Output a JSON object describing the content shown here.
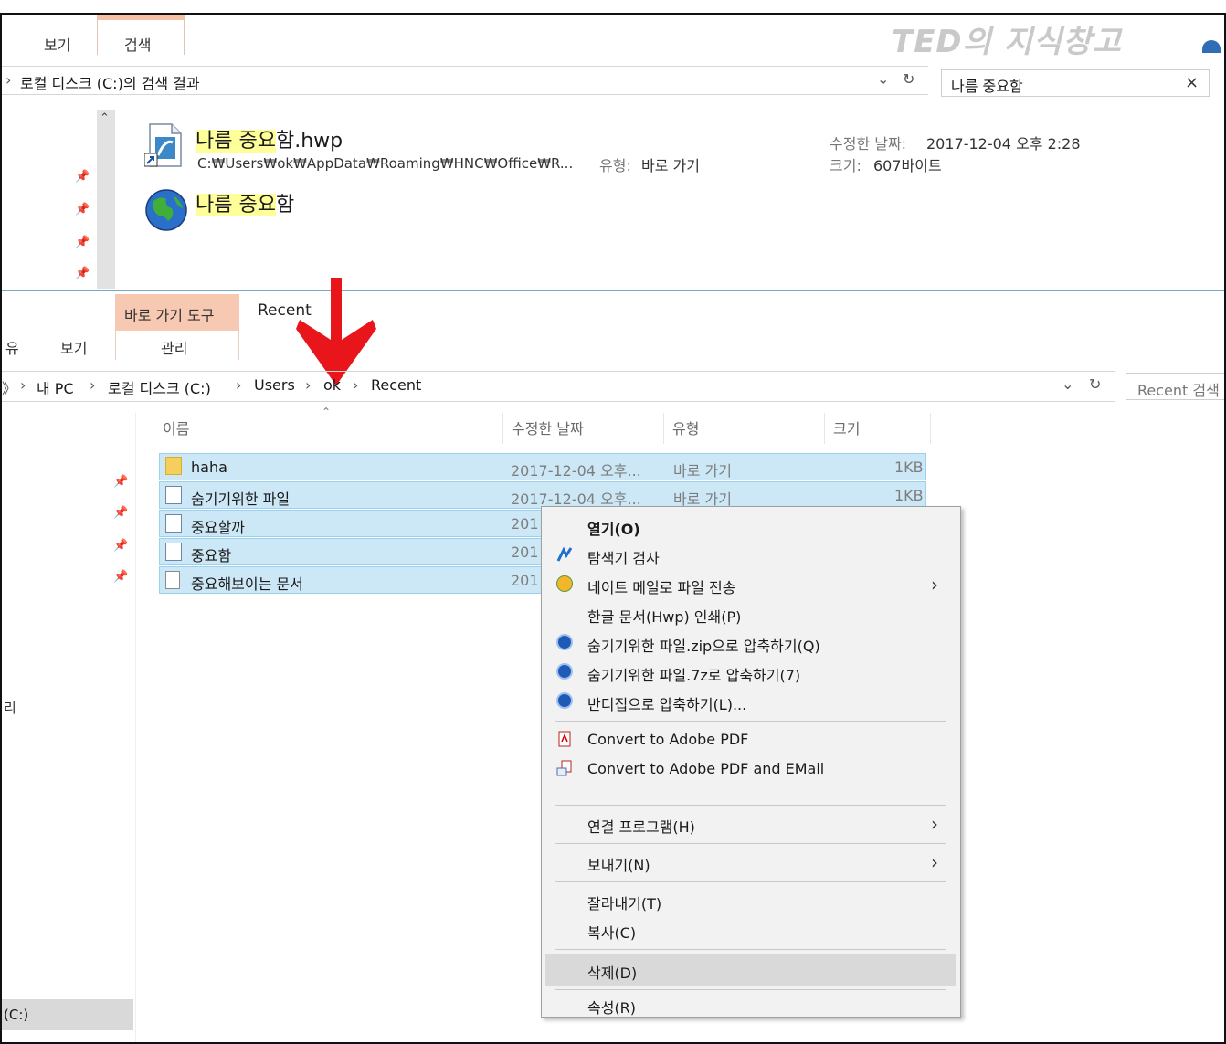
{
  "watermark": "TED의 지식창고",
  "top_window": {
    "tabs": [
      "보기",
      "검색"
    ],
    "address": "로컬 디스크 (C:)의 검색 결과",
    "search_value": "나름 중요함",
    "result1": {
      "name_highlight": "나름 중요",
      "name_rest": "함.hwp",
      "path": "C:₩Users₩ok₩AppData₩Roaming₩HNC₩Office₩R...",
      "type_label": "유형:",
      "type_value": "바로 가기",
      "date_label": "수정한 날짜:",
      "date_value": "2017-12-04 오후 2:28",
      "size_label": "크기:",
      "size_value": "607바이트"
    },
    "result2": {
      "name_highlight": "나름 중요",
      "name_rest": "함"
    }
  },
  "bottom_window": {
    "context_tab": "바로 가기 도구",
    "window_title": "Recent",
    "tab_share": "유",
    "tab_view": "보기",
    "tab_manage": "관리",
    "breadcrumb": {
      "lead": "》",
      "items": [
        "내 PC",
        "로컬 디스크 (C:)",
        "Users",
        "ok",
        "Recent"
      ],
      "sep": "›"
    },
    "search_placeholder": "Recent 검색",
    "columns": [
      "이름",
      "수정한 날짜",
      "유형",
      "크기"
    ],
    "rows": [
      {
        "name": "haha",
        "date": "2017-12-04 오후...",
        "type": "바로 가기",
        "size": "1KB"
      },
      {
        "name": "숨기기위한 파일",
        "date": "2017-12-04 오후...",
        "type": "바로 가기",
        "size": "1KB"
      },
      {
        "name": "중요할까",
        "date": "201"
      },
      {
        "name": "중요함",
        "date": "201"
      },
      {
        "name": "중요해보이는 문서",
        "date": "201"
      }
    ],
    "left_fragment": "리",
    "nav_selected": "(C:)"
  },
  "context_menu": {
    "items": [
      {
        "label": "열기(O)",
        "bold": true
      },
      {
        "label": "탐색기 검사"
      },
      {
        "label": "네이트 메일로 파일 전송"
      },
      {
        "label": "한글 문서(Hwp) 인쇄(P)"
      },
      {
        "label": "숨기기위한 파일.zip으로 압축하기(Q)"
      },
      {
        "label": "숨기기위한 파일.7z로 압축하기(7)"
      },
      {
        "label": "반디집으로 압축하기(L)..."
      },
      {
        "label": "Convert to Adobe PDF"
      },
      {
        "label": "Convert to Adobe PDF and EMail"
      },
      {
        "label": "연결 프로그램(H)"
      },
      {
        "label": "보내기(N)"
      },
      {
        "label": "잘라내기(T)"
      },
      {
        "label": "복사(C)"
      },
      {
        "label": "삭제(D)"
      },
      {
        "label": "속성(R)"
      }
    ],
    "submenu_arrow": "›"
  },
  "colors": {
    "accent_arrow": "#e8161b",
    "selection": "#cce8f7",
    "highlight": "#ffff99"
  }
}
